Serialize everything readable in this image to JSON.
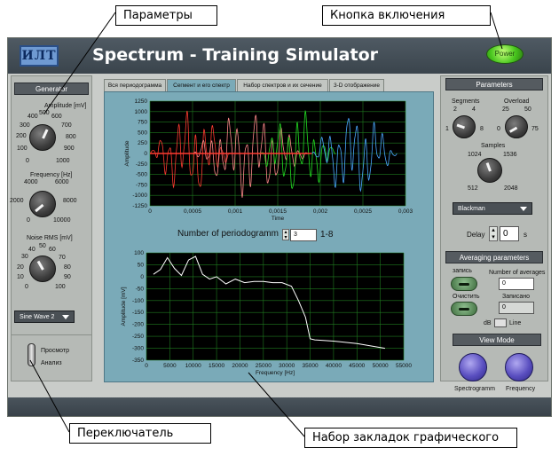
{
  "callouts": {
    "params": "Параметры",
    "power": "Кнопка включения",
    "switch": "Переключатель",
    "tabs": "Набор закладок графического"
  },
  "window": {
    "logo": "ИЛТ",
    "title": "Spectrum - Training Simulator",
    "power_label": "Power"
  },
  "left": {
    "generator_button": "Generator",
    "amplitude": {
      "title": "Amplitude [mV]",
      "ticks": [
        "400",
        "500",
        "600",
        "300",
        "700",
        "200",
        "800",
        "100",
        "900",
        "0",
        "1000"
      ]
    },
    "frequency": {
      "title": "Frequency [Hz]",
      "ticks": [
        "4000",
        "6000",
        "2000",
        "8000",
        "0",
        "10000"
      ]
    },
    "noise": {
      "title": "Noise RMS [mV]",
      "ticks": [
        "40",
        "50",
        "60",
        "30",
        "70",
        "20",
        "80",
        "10",
        "90",
        "0",
        "100"
      ]
    },
    "waveform": "Sine Wave 2",
    "mode_top": "Просмотр",
    "mode_bottom": "Анализ"
  },
  "tabs": [
    "Вся периодограмма",
    "Сегмент и его спектр",
    "Набор спектров и их сечение",
    "3-D отображение"
  ],
  "periodogram": {
    "label": "Number of periodogramm",
    "value": "3",
    "range": "1-8"
  },
  "right": {
    "parameters_button": "Parameters",
    "segments": {
      "title": "Segments",
      "ticks": [
        "2",
        "4",
        "1",
        "8"
      ]
    },
    "overload": {
      "title": "Overload",
      "ticks": [
        "25",
        "50",
        "0",
        "75"
      ]
    },
    "samples": {
      "title": "Samples",
      "ticks": [
        "1024",
        "1536",
        "512",
        "2048"
      ]
    },
    "window_func": "Blackman",
    "delay_label": "Delay",
    "delay_value": "0",
    "delay_unit": "s",
    "averaging_button": "Averaging parameters",
    "record_label": "запись",
    "number_of_averages": "Number of averages",
    "number_value": "0",
    "clear_label": "Очистить",
    "recorded_label": "Записано",
    "recorded_value": "0",
    "db_label": "dB",
    "line_label": "Line",
    "viewmode_button": "View Mode",
    "spectrogram_label": "Spectrogramm",
    "frequency_label": "Frequency"
  },
  "chart_data": [
    {
      "type": "line",
      "ylabel": "Amplitude",
      "xlabel": "Time",
      "xlim": [
        0,
        0.003
      ],
      "ylim": [
        -1250,
        1250
      ],
      "xticks": [
        "0",
        "0,0005",
        "0,001",
        "0,0015",
        "0,002",
        "0,0025",
        "0,003"
      ],
      "yticks": [
        "1250",
        "1000",
        "750",
        "500",
        "250",
        "0",
        "-250",
        "-500",
        "-750",
        "-1000",
        "-1250"
      ],
      "grid": true
    },
    {
      "type": "line",
      "ylabel": "Amplitude [mV]",
      "xlabel": "Frequency [Hz]",
      "xlim": [
        0,
        55000
      ],
      "ylim": [
        -350,
        100
      ],
      "xticks": [
        "0",
        "5000",
        "10000",
        "15000",
        "20000",
        "25000",
        "30000",
        "35000",
        "40000",
        "45000",
        "50000",
        "55000"
      ],
      "yticks": [
        "100",
        "50",
        "0",
        "-50",
        "-100",
        "-150",
        "-200",
        "-250",
        "-300",
        "-350"
      ],
      "grid": true,
      "x": [
        1500,
        3000,
        4500,
        6000,
        7500,
        9000,
        10500,
        12000,
        13500,
        15000,
        17000,
        19000,
        21000,
        23000,
        25000,
        27000,
        29000,
        31000,
        32500,
        34000,
        35000,
        36000,
        40000,
        45000,
        51000
      ],
      "y": [
        10,
        30,
        80,
        35,
        5,
        70,
        85,
        10,
        -10,
        0,
        -30,
        -10,
        -25,
        -20,
        -20,
        -25,
        -25,
        -40,
        -100,
        -170,
        -260,
        -265,
        -270,
        -280,
        -300
      ]
    }
  ]
}
